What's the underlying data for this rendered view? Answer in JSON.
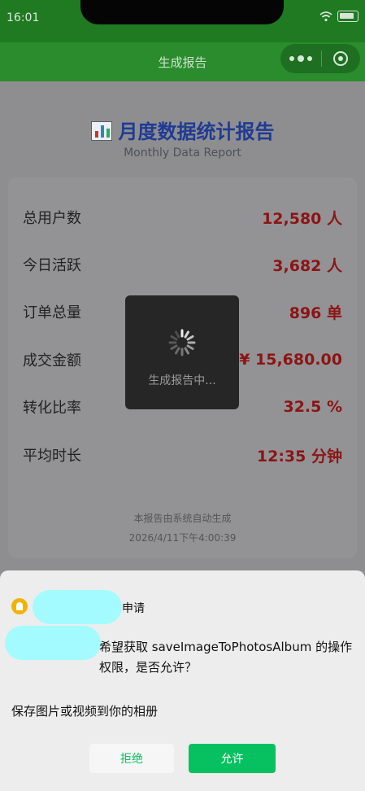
{
  "status_bar": {
    "time": "16:01"
  },
  "nav": {
    "title": "生成报告"
  },
  "report": {
    "title": "月度数据统计报告",
    "subtitle": "Monthly Data Report",
    "rows": [
      {
        "label": "总用户数",
        "value": "12,580 人"
      },
      {
        "label": "今日活跃",
        "value": "3,682 人"
      },
      {
        "label": "订单总量",
        "value": "896 单"
      },
      {
        "label": "成交金额",
        "value": "¥ 15,680.00"
      },
      {
        "label": "转化比率",
        "value": "32.5 %"
      },
      {
        "label": "平均时长",
        "value": "12:35 分钟"
      }
    ],
    "footer": {
      "note": "本报告由系统自动生成",
      "timestamp": "2026/4/11下午4:00:39"
    }
  },
  "loading": {
    "text": "生成报告中..."
  },
  "permission": {
    "apply": "申请",
    "description": "希望获取 saveImageToPhotosAlbum 的操作权限，是否允许？",
    "scope": "保存图片或视频到你的相册",
    "deny_label": "拒绝",
    "allow_label": "允许"
  },
  "colors": {
    "nav_green": "#2a8c2c",
    "value_red": "#8c1414",
    "title_blue": "#203b93",
    "allow_green": "#07c160",
    "redaction": "#a4fbff"
  }
}
